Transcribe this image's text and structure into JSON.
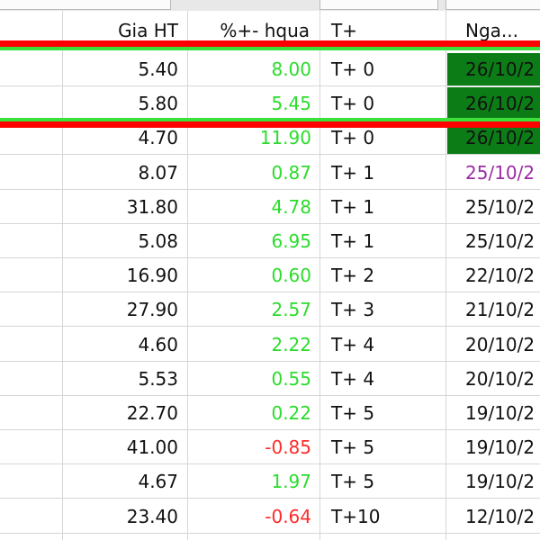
{
  "header": {
    "price": "Gia HT",
    "change": "%+- hqua",
    "tplus": "T+",
    "date": "Nga..."
  },
  "rows": [
    {
      "price": "5.40",
      "change": "8.00",
      "tplus": "T+ 0",
      "date": "26/10/2"
    },
    {
      "price": "5.80",
      "change": "5.45",
      "tplus": "T+ 0",
      "date": "26/10/2"
    },
    {
      "price": "4.70",
      "change": "11.90",
      "tplus": "T+ 0",
      "date": "26/10/2"
    },
    {
      "price": "8.07",
      "change": "0.87",
      "tplus": "T+ 1",
      "date": "25/10/2"
    },
    {
      "price": "31.80",
      "change": "4.78",
      "tplus": "T+ 1",
      "date": "25/10/2"
    },
    {
      "price": "5.08",
      "change": "6.95",
      "tplus": "T+ 1",
      "date": "25/10/2"
    },
    {
      "price": "16.90",
      "change": "0.60",
      "tplus": "T+ 2",
      "date": "22/10/2"
    },
    {
      "price": "27.90",
      "change": "2.57",
      "tplus": "T+ 3",
      "date": "21/10/2"
    },
    {
      "price": "4.60",
      "change": "2.22",
      "tplus": "T+ 4",
      "date": "20/10/2"
    },
    {
      "price": "5.53",
      "change": "0.55",
      "tplus": "T+ 4",
      "date": "20/10/2"
    },
    {
      "price": "22.70",
      "change": "0.22",
      "tplus": "T+ 5",
      "date": "19/10/2"
    },
    {
      "price": "41.00",
      "change": "-0.85",
      "tplus": "T+ 5",
      "date": "19/10/2"
    },
    {
      "price": "4.67",
      "change": "1.97",
      "tplus": "T+ 5",
      "date": "19/10/2"
    },
    {
      "price": "23.40",
      "change": "-0.64",
      "tplus": "T+10",
      "date": "12/10/2"
    }
  ],
  "colors": {
    "positive": "#2bdc2b",
    "negative": "#ff2a2a",
    "highlight_date": "#0c7d16",
    "purple_date": "#9b2ba3",
    "marker_red": "#ff0000",
    "marker_green": "#3be03b"
  }
}
